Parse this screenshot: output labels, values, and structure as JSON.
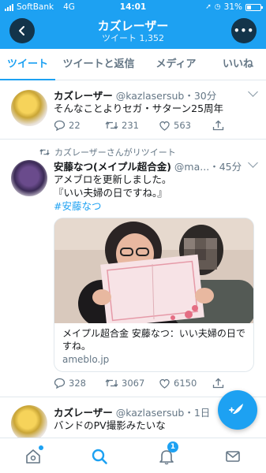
{
  "status_bar": {
    "carrier": "SoftBank",
    "network": "4G",
    "time": "14:01",
    "battery": "31%"
  },
  "header": {
    "title": "カズレーザー",
    "subtitle": "ツイート 1,352",
    "more_label": "•••"
  },
  "tabs": [
    {
      "label": "ツイート",
      "active": true
    },
    {
      "label": "ツイートと返信",
      "active": false
    },
    {
      "label": "メディア",
      "active": false
    },
    {
      "label": "いいね",
      "active": false
    }
  ],
  "tweets": [
    {
      "name": "カズレーザー",
      "handle": "@kazlasersub",
      "time": "・30分",
      "text": "そんなことよりセガ・サターン25周年",
      "replies": "22",
      "retweets": "231",
      "likes": "563"
    },
    {
      "retweet_note": "カズレーザーさんがリツイート",
      "name": "安藤なつ(メイプル超合金)",
      "handle": "@ma...",
      "time": "・45分",
      "text_lines": [
        "アメブロを更新しました。",
        "『いい夫婦の日ですね。』"
      ],
      "hashtag": "#安藤なつ",
      "card_title": "メイプル超合金 安藤なつ：いい夫婦の日ですね。",
      "card_domain": "ameblo.jp",
      "replies": "328",
      "retweets": "3067",
      "likes": "6150"
    },
    {
      "name": "カズレーザー",
      "handle": "@kazlasersub",
      "time": "・1日",
      "text": "バンドのPV撮影みたいな"
    }
  ],
  "bottom_nav": {
    "notification_count": "1"
  },
  "colors": {
    "accent": "#1da1f2",
    "text": "#14171a",
    "secondary": "#657786",
    "border": "#e1e8ed"
  }
}
